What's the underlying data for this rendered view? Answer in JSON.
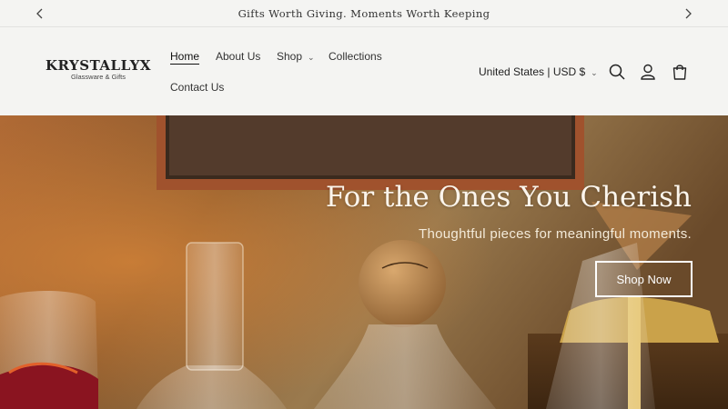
{
  "announcement": {
    "text": "Gifts Worth Giving. Moments Worth Keeping",
    "prev_icon": "chevron-left-icon",
    "next_icon": "chevron-right-icon"
  },
  "logo": {
    "name": "KRYSTALLYX",
    "tagline": "Glassware & Gifts"
  },
  "nav": {
    "home": "Home",
    "about": "About Us",
    "shop": "Shop",
    "collections": "Collections",
    "contact": "Contact Us"
  },
  "header": {
    "currency": "United States | USD $",
    "icons": [
      "search-icon",
      "account-icon",
      "cart-icon"
    ]
  },
  "hero": {
    "title": "For the Ones You Cherish",
    "subtitle": "Thoughtful pieces for meaningful moments.",
    "button_label": "Shop Now"
  },
  "colors": {
    "background": "#f4f4f2",
    "hero_text": "#fbf5ec"
  }
}
